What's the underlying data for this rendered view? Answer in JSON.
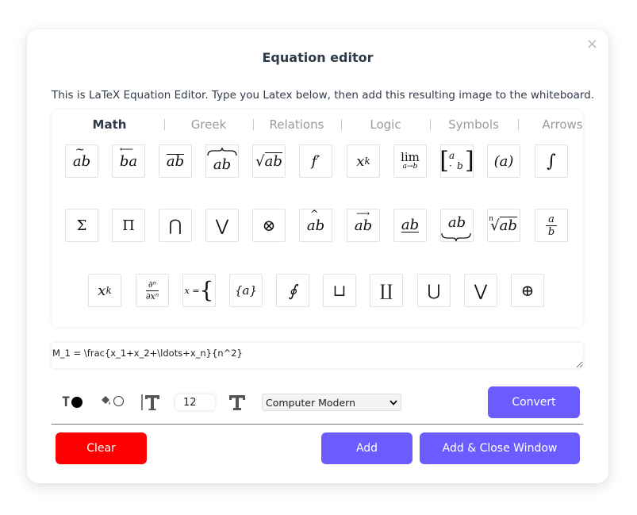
{
  "dialog": {
    "title": "Equation editor",
    "close_glyph": "×",
    "description": "This is LaTeX Equation Editor. Type you Latex below, then add this resulting image to the whiteboard."
  },
  "tabs": [
    {
      "label": "Math",
      "active": true
    },
    {
      "label": "Greek",
      "active": false
    },
    {
      "label": "Relations",
      "active": false
    },
    {
      "label": "Logic",
      "active": false
    },
    {
      "label": "Symbols",
      "active": false
    },
    {
      "label": "Arrows",
      "active": false
    }
  ],
  "symbols": {
    "big_sum": "Σ",
    "big_prod": "Π",
    "big_cap": "⋂",
    "big_vee": "⋁",
    "otimes": "⊗",
    "contour_int": "∮",
    "sqcup": "⊔",
    "coprod": "∐",
    "big_cup": "⋃",
    "vee2": "⋁",
    "oplus": "⊕",
    "integral": "∫"
  },
  "symbol_text": {
    "ab": "ab",
    "ba": "ba",
    "f_prime": "f′",
    "x": "x",
    "k": "k",
    "lim": "lim",
    "lim_sub": "a→b",
    "m_a": "a",
    "m_b": "b",
    "m_dot": "·",
    "paren_a": "(a)",
    "frac_a": "a",
    "frac_b": "b",
    "root_n": "n",
    "partial_num": "∂ⁿ",
    "partial_den": "∂xⁿ",
    "x_eq": "x =",
    "brace_a": "{a}"
  },
  "latex": {
    "value": "M_1 = \\frac{x_1+x_2+\\ldots+x_n}{n^2}"
  },
  "toolbar": {
    "text_color_glyph": "T",
    "font_size": "12",
    "font_family": "Computer Modern"
  },
  "buttons": {
    "convert": "Convert",
    "clear": "Clear",
    "add": "Add",
    "add_close": "Add & Close Window"
  },
  "colors": {
    "primary": "#6b5cff",
    "danger": "#ff0000"
  }
}
